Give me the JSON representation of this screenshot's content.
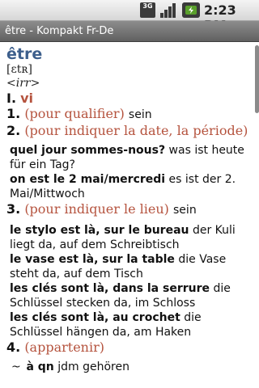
{
  "status_bar": {
    "network_label": "3G",
    "time": "2:23 PM",
    "icons": [
      "network-3g-icon",
      "signal-strength-icon",
      "battery-icon"
    ]
  },
  "title_bar": {
    "title": "être - Kompakt Fr-De"
  },
  "entry": {
    "headword": "être",
    "phonetic": "[ɛtʀ]",
    "grammar": "<irr>",
    "pos_number": "I.",
    "pos": "vi",
    "senses": [
      {
        "num": "1.",
        "gloss": "(pour qualifier)",
        "translation": "sein"
      },
      {
        "num": "2.",
        "gloss": "(pour indiquer la date, la période)",
        "examples": [
          {
            "fr": "quel jour sommes-nous?",
            "de": "was ist heute für ein Tag?"
          },
          {
            "fr": "on est le 2 mai/mercredi",
            "de": "es ist der 2. Mai/Mittwoch"
          }
        ]
      },
      {
        "num": "3.",
        "gloss": "(pour indiquer le lieu)",
        "translation": "sein",
        "examples": [
          {
            "fr": "le stylo est là, sur le bureau",
            "de": "der Kuli liegt da, auf dem Schreibtisch"
          },
          {
            "fr": "le vase est là, sur la table",
            "de": "die Vase steht da, auf dem Tisch"
          },
          {
            "fr": "les clés sont là, dans la serrure",
            "de": "die Schlüssel stecken da, im Schloss"
          },
          {
            "fr": "les clés sont là, au crochet",
            "de": "die Schlüssel hängen da, am Haken"
          }
        ]
      },
      {
        "num": "4.",
        "gloss": "(appartenir)",
        "sub": {
          "tilde": "~",
          "fr": "à qn",
          "de": "jdm gehören"
        }
      }
    ]
  },
  "colors": {
    "headword": "#3d5f8c",
    "gloss": "#b5533e",
    "title_bar": "#707070",
    "status_bar": "#e0e0e0"
  }
}
